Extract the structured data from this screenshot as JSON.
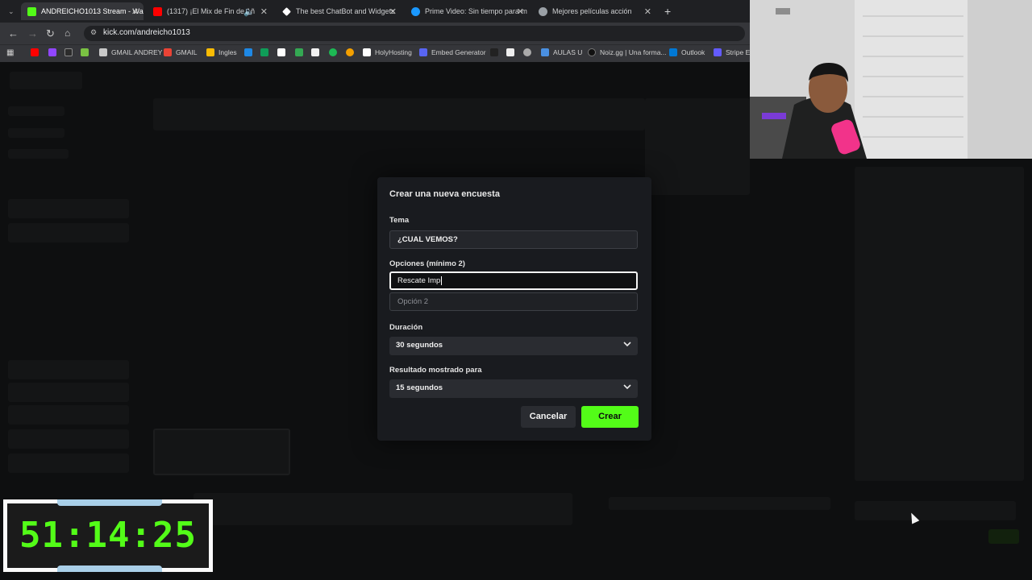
{
  "browser": {
    "tabs": [
      {
        "title": "ANDREICHO1013 Stream - Wa",
        "active": true,
        "icon_color": "#53fc18"
      },
      {
        "title": "(1317) ¡El Mix de Fin de Añ",
        "active": false,
        "icon_color": "#ff0000"
      },
      {
        "title": "The best ChatBot and Widgets",
        "active": false,
        "icon_color": "#ffffff"
      },
      {
        "title": "Prime Video: Sin tiempo para m",
        "active": false,
        "icon_color": "#1a98ff"
      },
      {
        "title": "Mejores películas acción",
        "active": false,
        "icon_color": "#9aa0a6"
      }
    ],
    "url": "kick.com/andreicho1013",
    "bookmarks": [
      {
        "label": "GMAIL ANDREY",
        "color": "#c9c9c9"
      },
      {
        "label": "GMAIL",
        "color": "#ea4335"
      },
      {
        "label": "Ingles",
        "color": "#fbbc04"
      },
      {
        "label": "HolyHosting",
        "color": "#ffffff"
      },
      {
        "label": "Embed Generator",
        "color": "#5865f2"
      },
      {
        "label": "AULAS U",
        "color": "#4a90e2"
      },
      {
        "label": "Noiz.gg | Una forma...",
        "color": "#111111"
      },
      {
        "label": "Outlook",
        "color": "#0078d4"
      },
      {
        "label": "Stripe Ex",
        "color": "#635bff"
      }
    ]
  },
  "timer": {
    "value": "51:14:25",
    "color": "#53fc18"
  },
  "modal": {
    "title": "Crear una nueva encuesta",
    "topic_label": "Tema",
    "topic_value": "¿CUAL VEMOS?",
    "options_label": "Opciones (mínimo 2)",
    "option1_value": "Rescate Imp",
    "option2_placeholder": "Opción 2",
    "duration_label": "Duración",
    "duration_value": "30 segundos",
    "result_label": "Resultado mostrado para",
    "result_value": "15 segundos",
    "cancel_label": "Cancelar",
    "create_label": "Crear",
    "accent": "#53fc18"
  }
}
